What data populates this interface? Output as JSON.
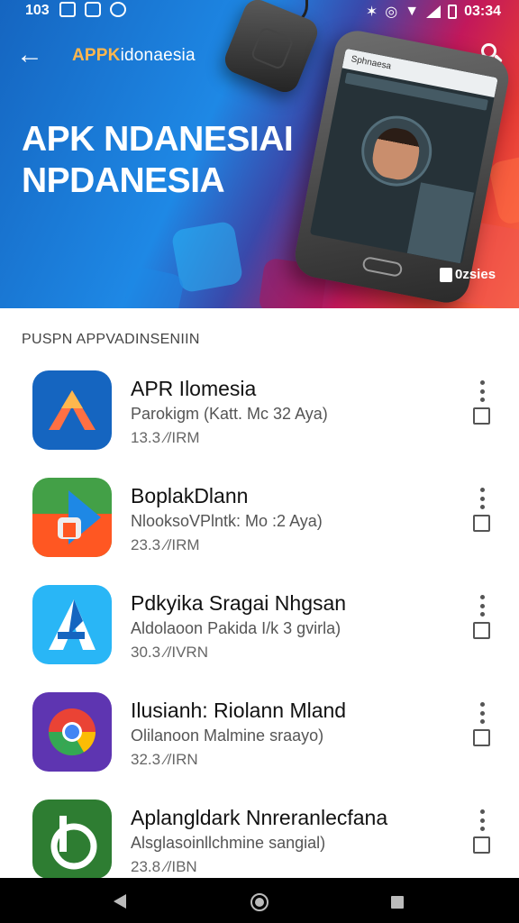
{
  "status_bar": {
    "time_left": "103",
    "time_right": "03:34",
    "icons_left": [
      "notification-box-icon",
      "photo-icon",
      "messenger-icon"
    ],
    "icons_right": [
      "bluetooth-icon",
      "alarm-icon",
      "wifi-icon",
      "signal-icon",
      "battery-icon"
    ]
  },
  "header": {
    "brand_prefix": "APPK",
    "brand_suffix": "idonaesia",
    "back_icon": "back-arrow-icon",
    "search_icon": "search-icon"
  },
  "hero": {
    "title_line1": "APK NDANESIAI",
    "title_line2": "NPDANESIA",
    "phone_screen_title": "Sphnaesa",
    "badge": "0zsies"
  },
  "section": {
    "title": "PUSPN APPVADINSENIIN"
  },
  "apps": [
    {
      "name": "APR Ilomesia",
      "subtitle": "Parokigm (Katt. Mc 32 Aya)",
      "size": "13.3 ⁄/IRM",
      "icon": "apk-indonesia-logo-icon",
      "color": "#1565c0"
    },
    {
      "name": "BoplakDlann",
      "subtitle": "NlooksoVPlntk: Mo :2 Aya)",
      "size": "23.3 ⁄/IRM",
      "icon": "play-store-logo-icon",
      "color": "#43a047"
    },
    {
      "name": "Pdkyika Sragai Nhgsan",
      "subtitle": "Aldolaoon Pakida I/k 3 gvirla)",
      "size": "30.3 ⁄/IVRN",
      "icon": "app-a-logo-icon",
      "color": "#29b6f6"
    },
    {
      "name": "Ilusianh: Riolann Mland",
      "subtitle": "Olilanoon Malmine sraayo)",
      "size": "32.3 ⁄/IRN",
      "icon": "chrome-logo-icon",
      "color": "#5e35b1"
    },
    {
      "name": "Aplangldark Nnreranlecfana",
      "subtitle": "Alsglasoinllchmine sangial)",
      "size": "23.8 ⁄/IBN",
      "icon": "b-logo-icon",
      "color": "#2e7d32"
    }
  ],
  "navbar": {
    "back": "nav-back-icon",
    "home": "nav-home-icon",
    "recent": "nav-recents-icon"
  }
}
